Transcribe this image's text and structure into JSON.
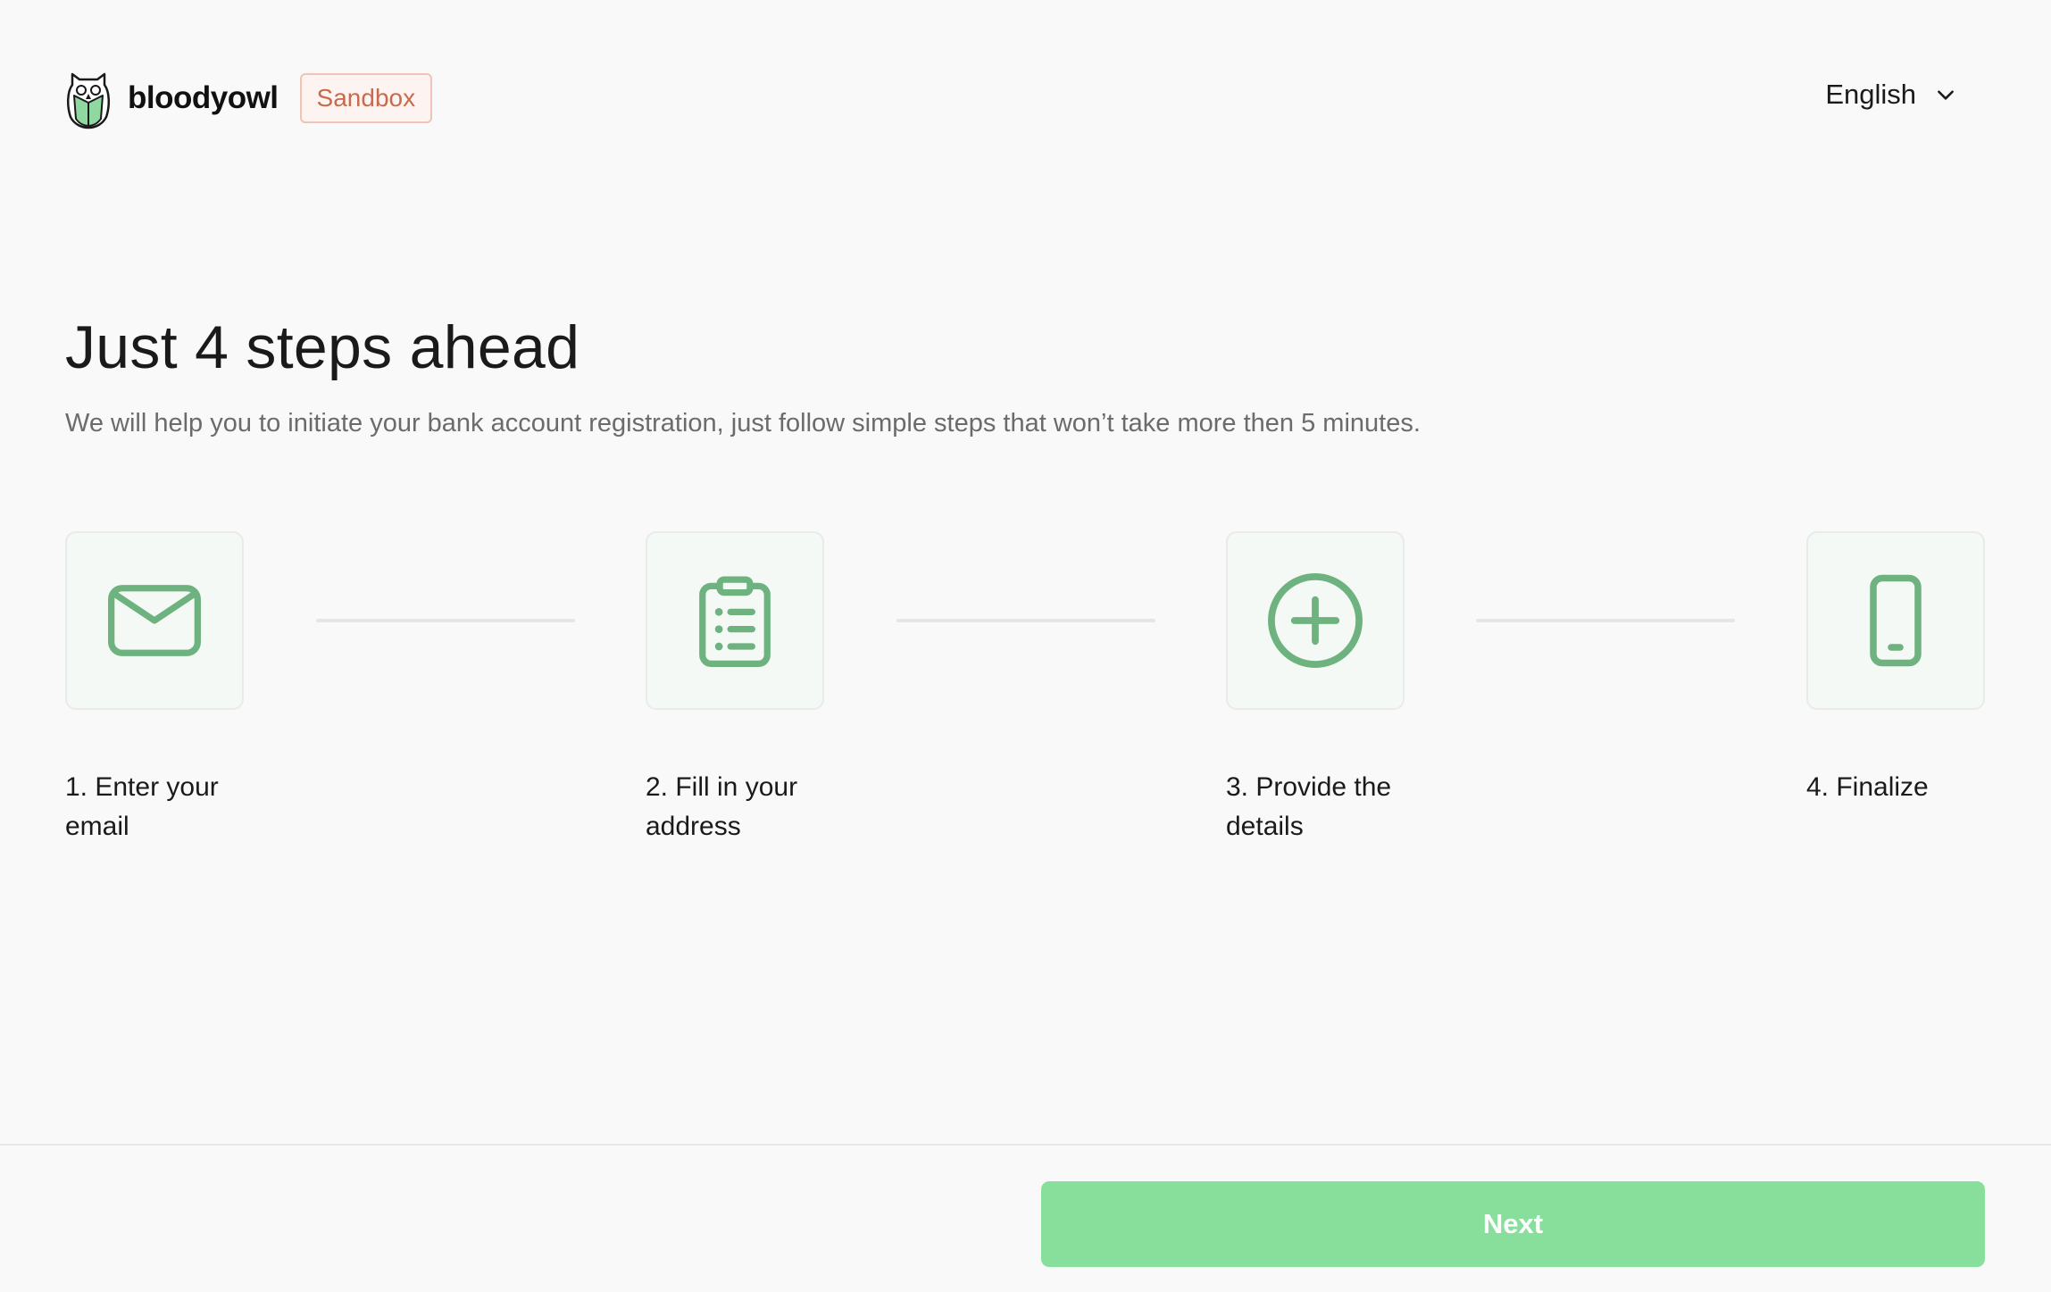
{
  "header": {
    "brand_name": "bloodyowl",
    "badge": "Sandbox",
    "language": "English"
  },
  "intro": {
    "title": "Just 4 steps ahead",
    "subtitle": "We will help you to initiate your bank account registration, just follow simple steps that won’t take more then 5 minutes."
  },
  "steps": [
    {
      "label": "1. Enter your email",
      "icon": "mail-icon"
    },
    {
      "label": "2. Fill in your address",
      "icon": "clipboard-list-icon"
    },
    {
      "label": "3. Provide the details",
      "icon": "plus-circle-icon"
    },
    {
      "label": "4. Finalize",
      "icon": "smartphone-icon"
    }
  ],
  "footer": {
    "next_label": "Next"
  },
  "colors": {
    "accent": "#88df9c",
    "icon": "#6db27f",
    "badge": "#c86a4c",
    "background": "#f9f9f9"
  }
}
